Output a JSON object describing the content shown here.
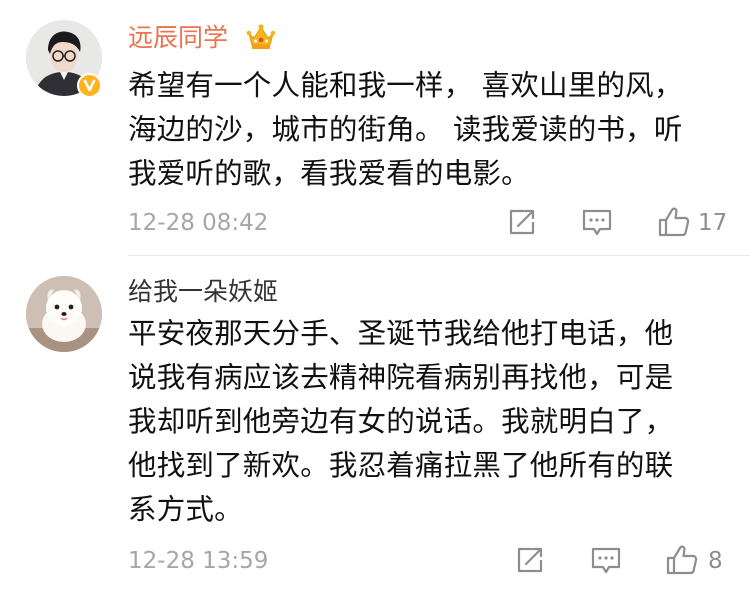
{
  "comments": [
    {
      "username": "远辰同学",
      "lines": [
        "希望有一个人能和我一样， 喜欢山里的风，",
        "海边的沙，城市的街角。 读我爱读的书，听",
        "我爱听的歌，看我爱看的电影。"
      ],
      "timestamp": "12-28 08:42",
      "likes": "17",
      "badges": [
        "crown-icon",
        "verified-v-icon"
      ],
      "colors": {
        "username": "#eb7350"
      }
    },
    {
      "username": "给我一朵妖姬",
      "lines": [
        "平安夜那天分手、圣诞节我给他打电话，他",
        "说我有病应该去精神院看病别再找他，可是",
        "我却听到他旁边有女的说话。我就明白了，",
        "他找到了新欢。我忍着痛拉黑了他所有的联",
        "系方式。"
      ],
      "timestamp": "12-28 13:59",
      "likes": "8",
      "colors": {
        "username": "#333333"
      }
    }
  ],
  "actions": [
    "share-icon",
    "reply-icon",
    "like-icon"
  ],
  "colors": {
    "meta": "#a6a6a6",
    "icon": "#8e8e8e",
    "text": "#111111"
  }
}
